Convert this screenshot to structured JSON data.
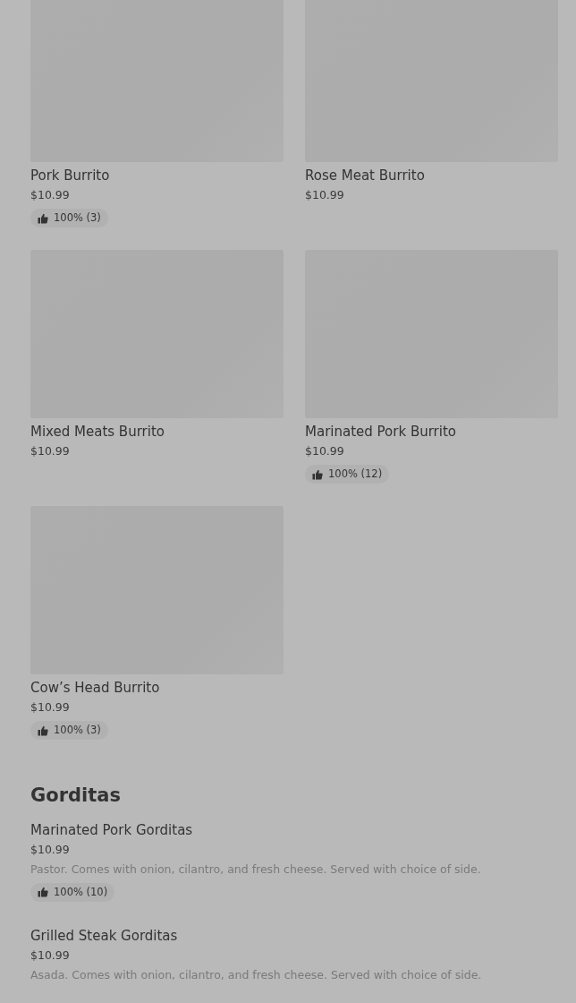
{
  "grid_items": [
    {
      "name": "Pork Burrito",
      "price": "$10.99",
      "rating": "100% (3)"
    },
    {
      "name": "Rose Meat Burrito",
      "price": "$10.99"
    },
    {
      "name": "Mixed Meats Burrito",
      "price": "$10.99"
    },
    {
      "name": "Marinated Pork Burrito",
      "price": "$10.99",
      "rating": "100% (12)"
    },
    {
      "name": "Cow’s Head Burrito",
      "price": "$10.99",
      "rating": "100% (3)"
    }
  ],
  "section": {
    "title": "Gorditas",
    "items": [
      {
        "name": "Marinated Pork Gorditas",
        "price": "$10.99",
        "description": "Pastor. Comes with onion, cilantro, and fresh cheese. Served with choice of side.",
        "rating": "100% (10)"
      },
      {
        "name": "Grilled Steak Gorditas",
        "price": "$10.99",
        "description": "Asada. Comes with onion, cilantro, and fresh cheese. Served with choice of side."
      }
    ]
  }
}
